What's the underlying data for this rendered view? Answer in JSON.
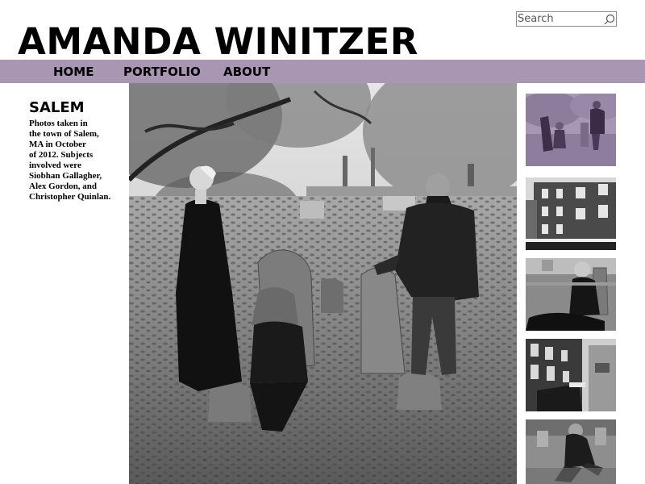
{
  "search": {
    "placeholder": "Search"
  },
  "site": {
    "title": "AMANDA WINITZER"
  },
  "nav": {
    "items": [
      {
        "label": "HOME"
      },
      {
        "label": "PORTFOLIO"
      },
      {
        "label": "ABOUT"
      }
    ]
  },
  "album": {
    "title": "SALEM",
    "description": "Photos taken in\nthe town of Salem,\nMA in October\nof 2012.  Subjects\ninvolved  were\nSiobhan Gallagher,\nAlex Gordon, and\nChristopher Quinlan."
  },
  "colors": {
    "nav_background": "#a896b3",
    "text": "#000000",
    "background": "#ffffff"
  },
  "icons": {
    "search": "magnifier-icon"
  },
  "thumbnails": [
    {
      "subject": "purple-tinted graveyard"
    },
    {
      "subject": "brick building"
    },
    {
      "subject": "seated woman"
    },
    {
      "subject": "street buildings"
    },
    {
      "subject": "crouching man"
    }
  ]
}
